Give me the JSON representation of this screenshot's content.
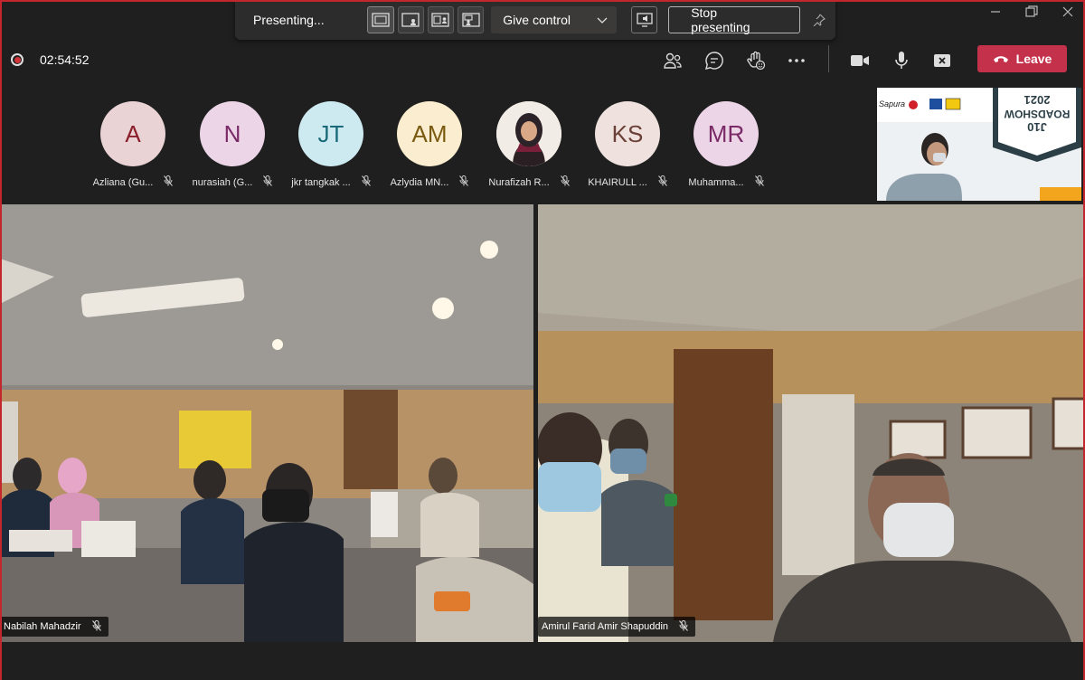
{
  "presenter_bar": {
    "label": "Presenting...",
    "give_control": "Give control",
    "stop_presenting": "Stop presenting"
  },
  "header": {
    "timer": "02:54:52",
    "leave_label": "Leave",
    "leave_color": "#c4314b"
  },
  "participants": [
    {
      "initials": "A",
      "name": "Azliana (Gu...",
      "color": "#ead3d5",
      "text_color": "#8a1f2b"
    },
    {
      "initials": "N",
      "name": "nurasiah (G...",
      "color": "#ecd5e6",
      "text_color": "#7a2a66"
    },
    {
      "initials": "JT",
      "name": "jkr tangkak ...",
      "color": "#cdeaf0",
      "text_color": "#1b6a7a"
    },
    {
      "initials": "AM",
      "name": "Azlydia MN...",
      "color": "#fbeed0",
      "text_color": "#7a5a10"
    },
    {
      "initials": "",
      "name": "Nurafizah R...",
      "color": "#f3e4dc",
      "text_color": "#000000"
    },
    {
      "initials": "KS",
      "name": "KHAIRULL ...",
      "color": "#efe2de",
      "text_color": "#6b4038"
    },
    {
      "initials": "MR",
      "name": "Muhamma...",
      "color": "#ecd5e6",
      "text_color": "#7a2a66"
    }
  ],
  "shared_content": {
    "logo_text": "Sapura",
    "banner_line1": "J10",
    "banner_line2": "ROADSHOW",
    "banner_line3": "2021"
  },
  "tiles": [
    {
      "name": "Nabilah Mahadzir"
    },
    {
      "name": "Amirul Farid Amir Shapuddin"
    }
  ]
}
